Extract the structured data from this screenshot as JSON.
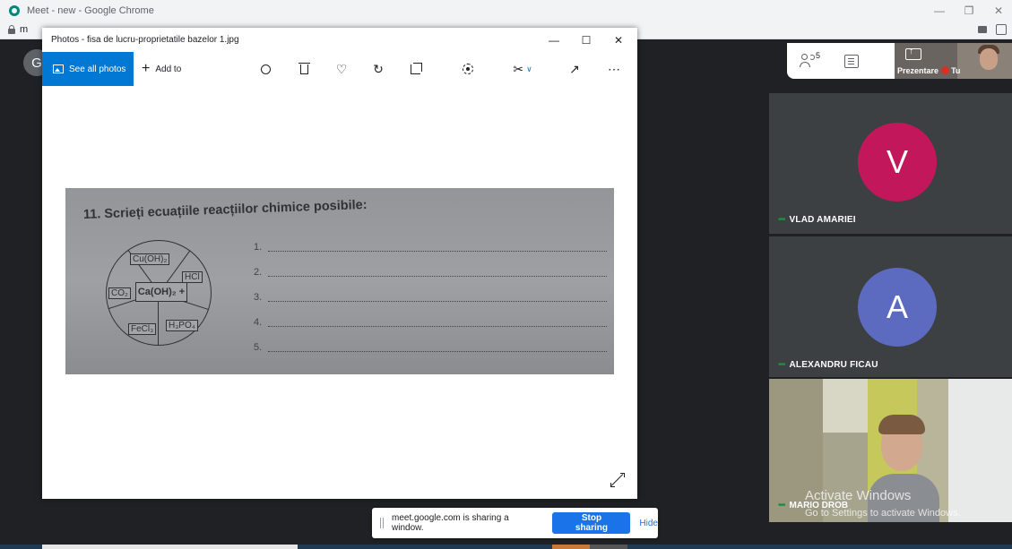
{
  "chrome": {
    "window_title": "Meet - new - Google Chrome",
    "url_partial": "m"
  },
  "meet": {
    "self_avatar_letter": "G",
    "toolbar": {
      "people_count": "5",
      "presenting_label": "Prezentare",
      "self_label": "Tu"
    },
    "participants": [
      {
        "initial": "V",
        "name": "VLAD AMARIEI",
        "avatar_color": "#c2185b"
      },
      {
        "initial": "A",
        "name": "ALEXANDRU FICAU",
        "avatar_color": "#5c6bc0"
      },
      {
        "name": "MARIO DROB"
      }
    ],
    "watermark": {
      "line1": "Activate Windows",
      "line2": "Go to Settings to activate Windows."
    },
    "sharing_bar": {
      "message": "meet.google.com is sharing a window.",
      "stop_label": "Stop sharing",
      "hide_label": "Hide"
    }
  },
  "photos_app": {
    "title": "Photos - fisa de lucru-proprietatile bazelor 1.jpg",
    "see_all_label": "See all photos",
    "add_to_label": "Add to",
    "photo": {
      "question": "11. Scrieți ecuațiile reacțiilor chimice posibile:",
      "center": "Ca(OH)₂ +",
      "reagents": [
        "Cu(OH)₂",
        "HCl",
        "CO₂",
        "FeCl₃",
        "H₃PO₄"
      ],
      "lines": [
        "1.",
        "2.",
        "3.",
        "4.",
        "5."
      ]
    }
  },
  "colors": {
    "accent_blue": "#0078d4",
    "meet_blue": "#1a73e8",
    "meet_bg": "#202124",
    "tile_bg": "#3c4043",
    "talk_dots": "#1e8e3e"
  }
}
